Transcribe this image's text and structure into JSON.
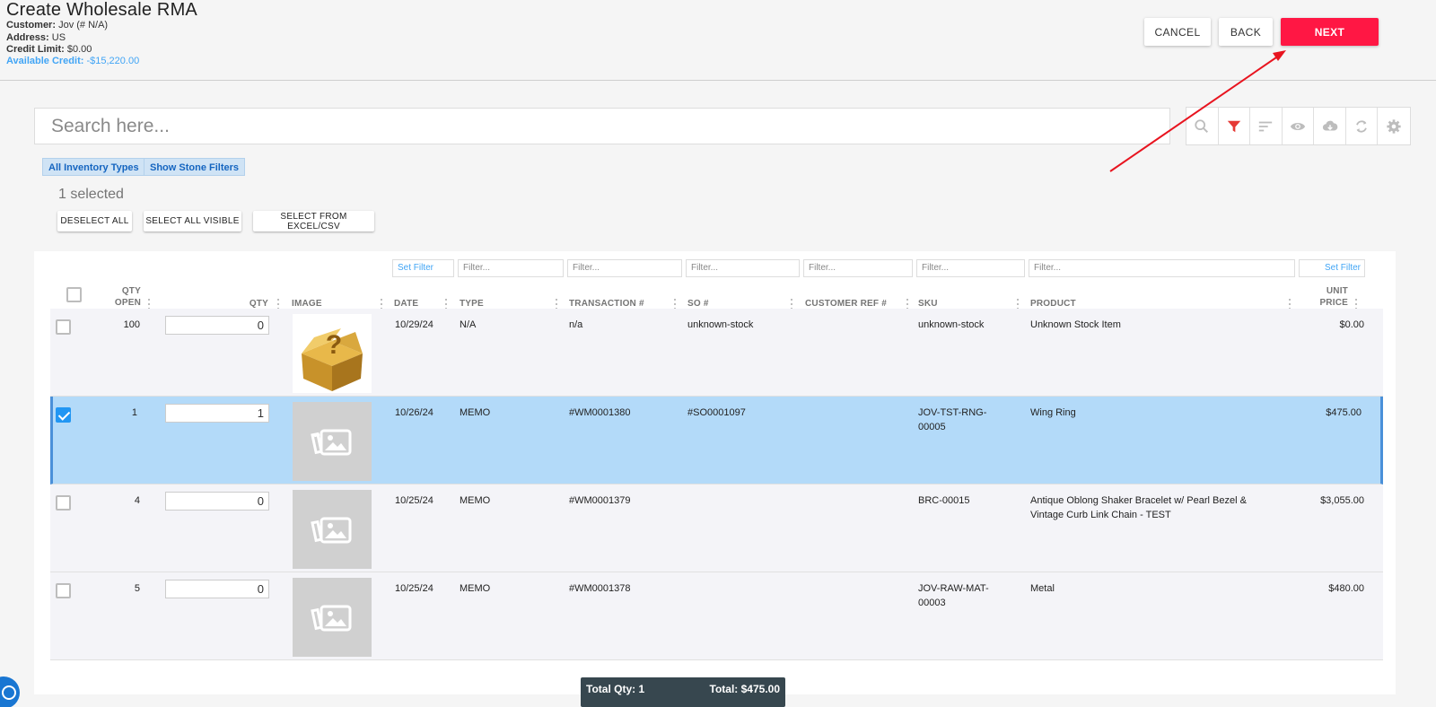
{
  "header": {
    "title": "Create Wholesale RMA",
    "customer_label": "Customer:",
    "customer_value": "Jov (# N/A)",
    "address_label": "Address:",
    "address_value": "US",
    "credit_limit_label": "Credit Limit:",
    "credit_limit_value": "$0.00",
    "available_credit_label": "Available Credit:",
    "available_credit_value": "-$15,220.00",
    "cancel_label": "CANCEL",
    "back_label": "BACK",
    "next_label": "NEXT"
  },
  "search": {
    "placeholder": "Search here..."
  },
  "toolbar": {
    "icons": [
      "search-icon",
      "filter-icon",
      "sort-icon",
      "eye-icon",
      "cloud-download-icon",
      "refresh-icon",
      "gear-icon"
    ],
    "active_color": "#e53935"
  },
  "chips": {
    "inventory_types": "All Inventory Types",
    "stone_filters": "Show Stone Filters"
  },
  "selection": {
    "count_text": "1 selected",
    "deselect_all": "DESELECT ALL",
    "select_all_visible": "SELECT ALL VISIBLE",
    "select_from_excel": "SELECT FROM EXCEL/CSV"
  },
  "filters": {
    "set_filter": "Set Filter",
    "placeholder": "Filter..."
  },
  "columns": {
    "qty_open_1": "QTY",
    "qty_open_2": "OPEN",
    "qty": "QTY",
    "image": "IMAGE",
    "date": "DATE",
    "type": "TYPE",
    "transaction": "TRANSACTION #",
    "so": "SO #",
    "customer_ref": "CUSTOMER REF #",
    "sku": "SKU",
    "product": "PRODUCT",
    "unit_price_1": "UNIT",
    "unit_price_2": "PRICE"
  },
  "rows": [
    {
      "selected": false,
      "qty_open": "100",
      "qty": "0",
      "date": "10/29/24",
      "type": "N/A",
      "transaction": "n/a",
      "so": "unknown-stock",
      "customer_ref": "",
      "sku_1": "unknown-stock",
      "sku_2": "",
      "product_1": "Unknown Stock Item",
      "product_2": "",
      "unit_price": "$0.00"
    },
    {
      "selected": true,
      "qty_open": "1",
      "qty": "1",
      "date": "10/26/24",
      "type": "MEMO",
      "transaction": "#WM0001380",
      "so": "#SO0001097",
      "customer_ref": "",
      "sku_1": "JOV-TST-RNG-",
      "sku_2": "00005",
      "product_1": "Wing Ring",
      "product_2": "",
      "unit_price": "$475.00"
    },
    {
      "selected": false,
      "qty_open": "4",
      "qty": "0",
      "date": "10/25/24",
      "type": "MEMO",
      "transaction": "#WM0001379",
      "so": "",
      "customer_ref": "",
      "sku_1": "BRC-00015",
      "sku_2": "",
      "product_1": "Antique Oblong Shaker Bracelet w/ Pearl Bezel &",
      "product_2": "Vintage Curb Link Chain - TEST",
      "unit_price": "$3,055.00"
    },
    {
      "selected": false,
      "qty_open": "5",
      "qty": "0",
      "date": "10/25/24",
      "type": "MEMO",
      "transaction": "#WM0001378",
      "so": "",
      "customer_ref": "",
      "sku_1": "JOV-RAW-MAT-",
      "sku_2": "00003",
      "product_1": "Metal",
      "product_2": "",
      "unit_price": "$480.00"
    }
  ],
  "totals": {
    "qty": "Total Qty: 1",
    "total": "Total: $475.00"
  },
  "colors": {
    "accent": "#ff1744",
    "selected_row": "#b3daf9",
    "link": "#42a5f5",
    "annotation_arrow": "#e8141f"
  }
}
